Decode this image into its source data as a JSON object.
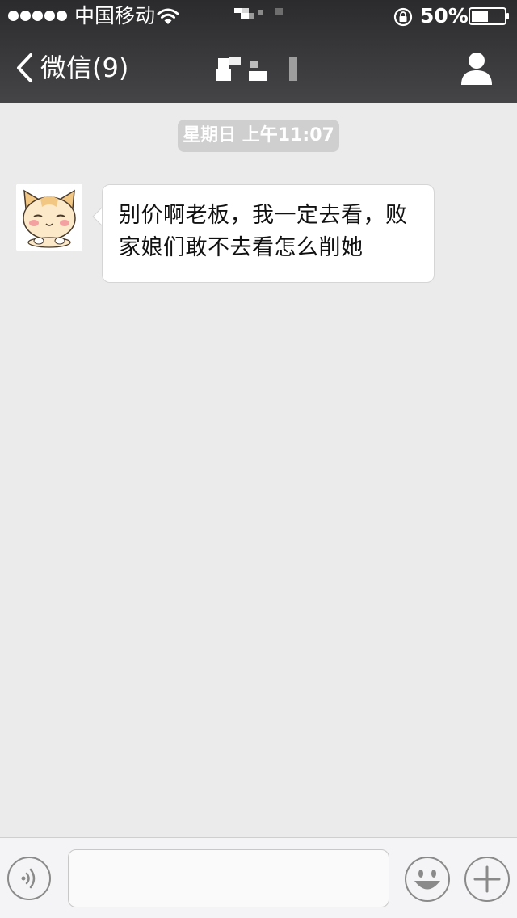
{
  "status_bar": {
    "carrier": "中国移动",
    "battery_percent": "50%",
    "battery_level": 0.5,
    "icons": [
      "signal-dots-icon",
      "wifi-icon",
      "rotation-lock-icon",
      "battery-icon"
    ]
  },
  "nav": {
    "back_label": "微信(9)",
    "title_pixelated": true,
    "icons": [
      "chevron-left-icon",
      "person-icon"
    ]
  },
  "chat": {
    "timestamp": "星期日 上午11:07",
    "messages": [
      {
        "sender": "incoming",
        "avatar": "cartoon-cat-avatar",
        "text": "别价啊老板，我一定去看，败家娘们敢不去看怎么削她"
      }
    ]
  },
  "input_bar": {
    "value": "",
    "placeholder": "",
    "icons": [
      "voice-icon",
      "emoji-icon",
      "plus-icon"
    ]
  },
  "colors": {
    "header_top": "#2b2b2d",
    "header_bottom": "#454547",
    "chat_background": "#ebebeb",
    "timestamp_background": "#cfcfcf",
    "bubble_background": "#ffffff",
    "input_bar_background": "#f4f4f6"
  }
}
